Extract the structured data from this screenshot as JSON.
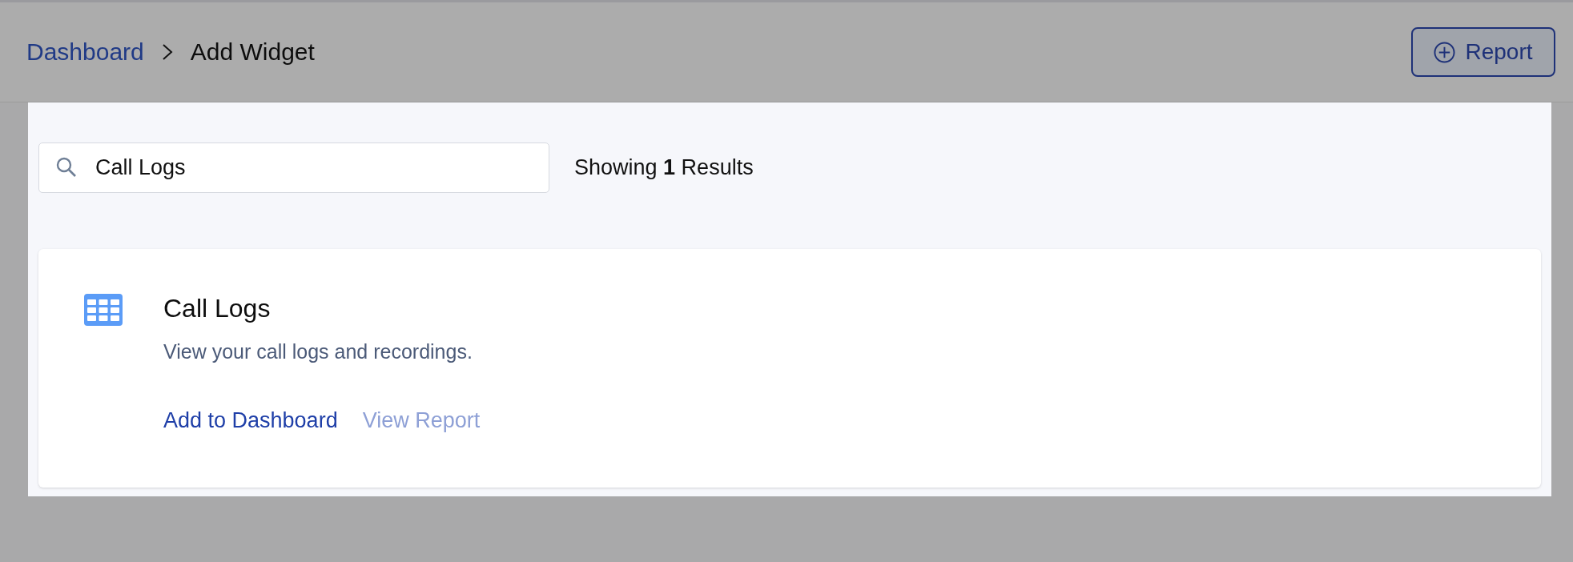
{
  "breadcrumb": [
    {
      "label": "Dashboard",
      "kind": "link"
    },
    {
      "label": "Add Widget",
      "kind": "current"
    }
  ],
  "header_button": {
    "label": "Report"
  },
  "search": {
    "value": "Call Logs"
  },
  "results": {
    "text": "Showing **1** Results"
  },
  "widgets": [
    {
      "title": "Call Logs",
      "description": "View your call logs and recordings.",
      "actions": [
        {
          "label": "Add to Dashboard",
          "disabled": false
        },
        {
          "label": "View Report",
          "disabled": true
        }
      ]
    }
  ]
}
